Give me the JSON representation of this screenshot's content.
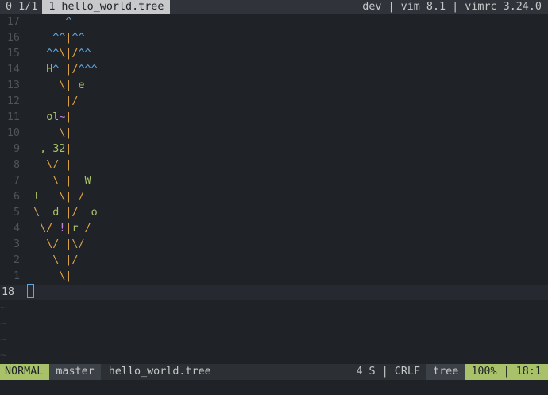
{
  "tabline": {
    "count": "0 1/1",
    "active_tab": "1 hello_world.tree",
    "right": "dev | vim 8.1 | vimrc 3.24.0"
  },
  "lines": [
    {
      "num": "17",
      "segs": [
        {
          "t": "      ",
          "c": ""
        },
        {
          "t": "^",
          "c": "bl"
        }
      ]
    },
    {
      "num": "16",
      "segs": [
        {
          "t": "    ",
          "c": ""
        },
        {
          "t": "^^",
          "c": "bl"
        },
        {
          "t": "|",
          "c": "or"
        },
        {
          "t": "^^",
          "c": "bl"
        }
      ]
    },
    {
      "num": "15",
      "segs": [
        {
          "t": "   ",
          "c": ""
        },
        {
          "t": "^^",
          "c": "bl"
        },
        {
          "t": "\\|/",
          "c": "or"
        },
        {
          "t": "^^",
          "c": "bl"
        }
      ]
    },
    {
      "num": "14",
      "segs": [
        {
          "t": "   ",
          "c": ""
        },
        {
          "t": "H",
          "c": "gr"
        },
        {
          "t": "^ ",
          "c": "bl"
        },
        {
          "t": "|/",
          "c": "or"
        },
        {
          "t": "^^^",
          "c": "bl"
        }
      ]
    },
    {
      "num": "13",
      "segs": [
        {
          "t": "     ",
          "c": ""
        },
        {
          "t": "\\|",
          "c": "or"
        },
        {
          "t": " e",
          "c": "gr"
        }
      ]
    },
    {
      "num": "12",
      "segs": [
        {
          "t": "      ",
          "c": ""
        },
        {
          "t": "|/",
          "c": "or"
        }
      ]
    },
    {
      "num": "11",
      "segs": [
        {
          "t": "   ",
          "c": ""
        },
        {
          "t": "ol",
          "c": "gr"
        },
        {
          "t": "~",
          "c": "pu"
        },
        {
          "t": "|",
          "c": "or"
        }
      ]
    },
    {
      "num": "10",
      "segs": [
        {
          "t": "     ",
          "c": ""
        },
        {
          "t": "\\|",
          "c": "or"
        }
      ]
    },
    {
      "num": "9",
      "segs": [
        {
          "t": "  ",
          "c": ""
        },
        {
          "t": ", 32",
          "c": "gr"
        },
        {
          "t": "|",
          "c": "or"
        }
      ]
    },
    {
      "num": "8",
      "segs": [
        {
          "t": "   ",
          "c": ""
        },
        {
          "t": "\\/ |",
          "c": "or"
        }
      ]
    },
    {
      "num": "7",
      "segs": [
        {
          "t": "    ",
          "c": ""
        },
        {
          "t": "\\ |",
          "c": "or"
        },
        {
          "t": "  W",
          "c": "gr"
        }
      ]
    },
    {
      "num": "6",
      "segs": [
        {
          "t": " ",
          "c": ""
        },
        {
          "t": "l",
          "c": "gr"
        },
        {
          "t": "   \\| /",
          "c": "or"
        }
      ]
    },
    {
      "num": "5",
      "segs": [
        {
          "t": " ",
          "c": ""
        },
        {
          "t": "\\",
          "c": "or"
        },
        {
          "t": "  d ",
          "c": "gr"
        },
        {
          "t": "|/",
          "c": "or"
        },
        {
          "t": "  o",
          "c": "gr"
        }
      ]
    },
    {
      "num": "4",
      "segs": [
        {
          "t": "  ",
          "c": ""
        },
        {
          "t": "\\/ ",
          "c": "or"
        },
        {
          "t": "!",
          "c": "pu"
        },
        {
          "t": "|",
          "c": "or"
        },
        {
          "t": "r",
          "c": "gr"
        },
        {
          "t": " /",
          "c": "or"
        }
      ]
    },
    {
      "num": "3",
      "segs": [
        {
          "t": "   ",
          "c": ""
        },
        {
          "t": "\\/ |\\/",
          "c": "or"
        }
      ]
    },
    {
      "num": "2",
      "segs": [
        {
          "t": "    ",
          "c": ""
        },
        {
          "t": "\\ |/",
          "c": "or"
        }
      ]
    },
    {
      "num": "1",
      "segs": [
        {
          "t": "     ",
          "c": ""
        },
        {
          "t": "\\|",
          "c": "or"
        }
      ]
    }
  ],
  "current_line_num": "18",
  "tilde": "~",
  "tilde_count": 4,
  "statusline": {
    "mode": "NORMAL",
    "branch": "master",
    "filename": "hello_world.tree",
    "info": "4 S | CRLF",
    "filetype": "tree",
    "position": "100% | 18:1"
  },
  "colors": {
    "background": "#1f2328",
    "orange": "#e0a44a",
    "blue": "#5fa8e0",
    "green": "#a9c26a",
    "purple": "#c386dc"
  }
}
